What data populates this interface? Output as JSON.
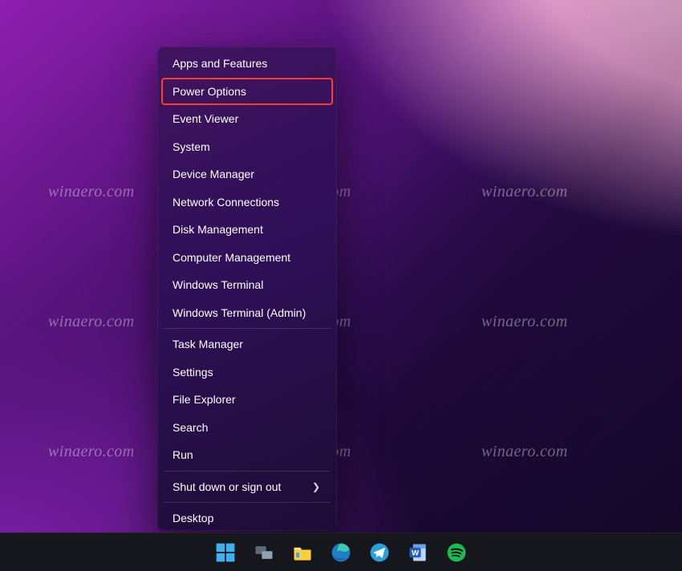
{
  "watermark_text": "winaero.com",
  "menu": {
    "groups": [
      [
        "Apps and Features",
        "Power Options",
        "Event Viewer",
        "System",
        "Device Manager",
        "Network Connections",
        "Disk Management",
        "Computer Management",
        "Windows Terminal",
        "Windows Terminal (Admin)"
      ],
      [
        "Task Manager",
        "Settings",
        "File Explorer",
        "Search",
        "Run"
      ],
      [
        "Shut down or sign out"
      ],
      [
        "Desktop"
      ]
    ],
    "highlighted": "Power Options",
    "submenu_items": [
      "Shut down or sign out"
    ]
  },
  "taskbar": {
    "items": [
      "Start",
      "Task View",
      "File Explorer",
      "Microsoft Edge",
      "Telegram",
      "Word",
      "Spotify"
    ]
  },
  "colors": {
    "highlight_outline": "#ff3b2f",
    "taskbar_bg": "#15171c"
  }
}
